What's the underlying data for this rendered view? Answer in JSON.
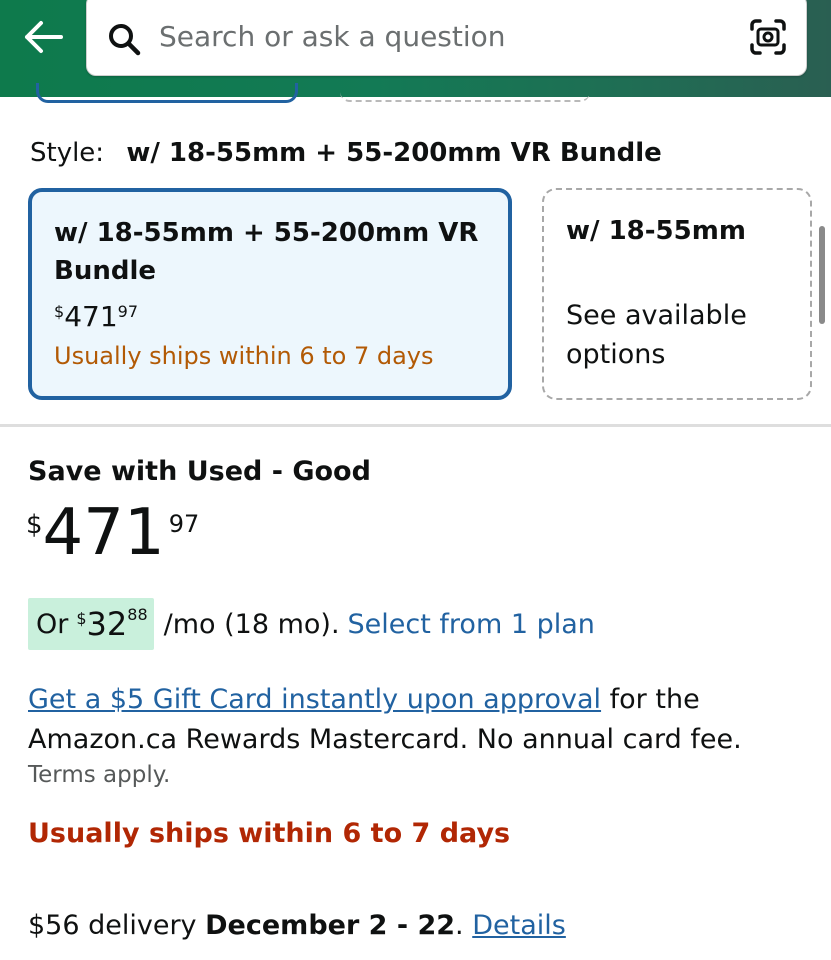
{
  "header": {
    "search_placeholder": "Search or ask a question",
    "back_icon": "arrow-left-icon",
    "search_icon": "magnifier-icon",
    "camera_icon": "camera-scan-icon",
    "background_color": "#0e7a4c"
  },
  "style_selector": {
    "label": "Style:",
    "selected_value": "w/ 18-55mm + 55-200mm VR Bundle",
    "options": [
      {
        "title": "w/ 18-55mm + 55-200mm VR Bundle",
        "price_symbol": "$",
        "price_whole": "471",
        "price_fraction": "97",
        "shipping": "Usually ships within 6 to 7 days",
        "selected": true
      },
      {
        "title": "w/ 18-55mm",
        "subtitle": "See available options",
        "selected": false
      }
    ]
  },
  "offer": {
    "title": "Save with Used - Good",
    "price_symbol": "$",
    "price_whole": "471",
    "price_fraction": "97",
    "installment": {
      "prefix": "Or",
      "symbol": "$",
      "whole": "32",
      "fraction": "88",
      "term": "/mo (18 mo).",
      "link": "Select from 1 plan"
    },
    "gift_card": {
      "link": "Get a $5 Gift Card instantly upon approval",
      "text": "for the Amazon.ca Rewards Mastercard. No annual card fee.",
      "terms": "Terms apply."
    },
    "availability": "Usually ships within 6 to 7 days",
    "delivery": {
      "price_text": "$56 delivery",
      "dates": "December 2 - 22",
      "period": ".",
      "link": "Details"
    }
  },
  "colors": {
    "link": "#2162a1",
    "availability_red": "#b12704",
    "shipping_orange": "#b25a05",
    "installment_highlight": "#c9f0dc"
  }
}
